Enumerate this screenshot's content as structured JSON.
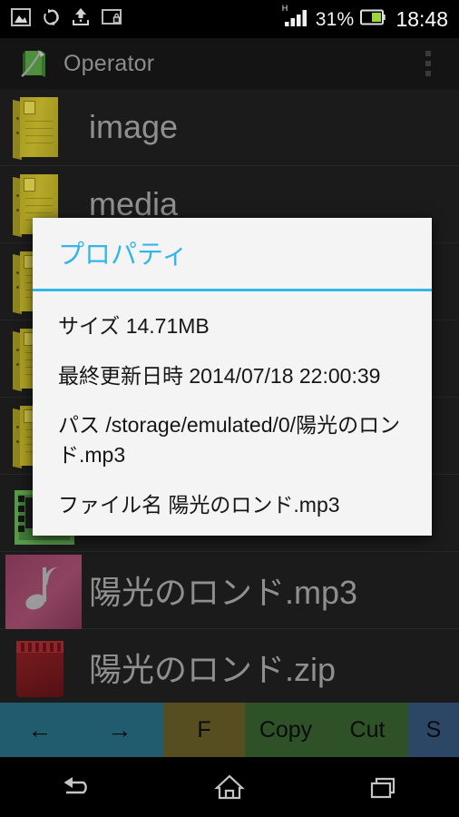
{
  "status_bar": {
    "icons": [
      "image-icon",
      "sync-icon",
      "upload-icon",
      "screen-lock-icon"
    ],
    "network_type": "H",
    "signal_icon": "signal-bars-icon",
    "battery_percent": "31%",
    "battery_icon": "battery-icon",
    "clock": "18:48"
  },
  "action_bar": {
    "logo_icon": "operator-app-logo",
    "title": "Operator",
    "overflow_icon": "overflow-menu-icon"
  },
  "file_list": {
    "items": [
      {
        "name": "image",
        "icon": "folder-icon",
        "type": "folder"
      },
      {
        "name": "media",
        "icon": "folder-icon",
        "type": "folder"
      },
      {
        "name": "",
        "icon": "folder-icon",
        "type": "folder"
      },
      {
        "name": "",
        "icon": "folder-icon",
        "type": "folder"
      },
      {
        "name": "",
        "icon": "folder-icon",
        "type": "folder"
      },
      {
        "name": "",
        "icon": "video-icon",
        "type": "video"
      },
      {
        "name": "陽光のロンド.mp3",
        "icon": "audio-icon",
        "type": "audio"
      },
      {
        "name": "陽光のロンド.zip",
        "icon": "zip-icon",
        "type": "archive"
      }
    ]
  },
  "dialog": {
    "title": "プロパティ",
    "accent_color": "#35b6e8",
    "background_color": "#f4f4f4",
    "properties": [
      "サイズ 14.71MB",
      "最終更新日時 2014/07/18 22:00:39",
      "パス /storage/emulated/0/陽光のロンド.mp3",
      "ファイル名 陽光のロンド.mp3"
    ]
  },
  "action_toolbar": {
    "back_label": "←",
    "forward_label": "→",
    "buttons": [
      {
        "label": "F",
        "color": "#564d20"
      },
      {
        "label": "Copy",
        "color": "#2f5127"
      },
      {
        "label": "Cut",
        "color": "#2f5127"
      },
      {
        "label": "S",
        "color": "#2c4765"
      }
    ]
  },
  "nav_bar": {
    "back_icon": "back-icon",
    "home_icon": "home-icon",
    "recents_icon": "recents-icon"
  }
}
